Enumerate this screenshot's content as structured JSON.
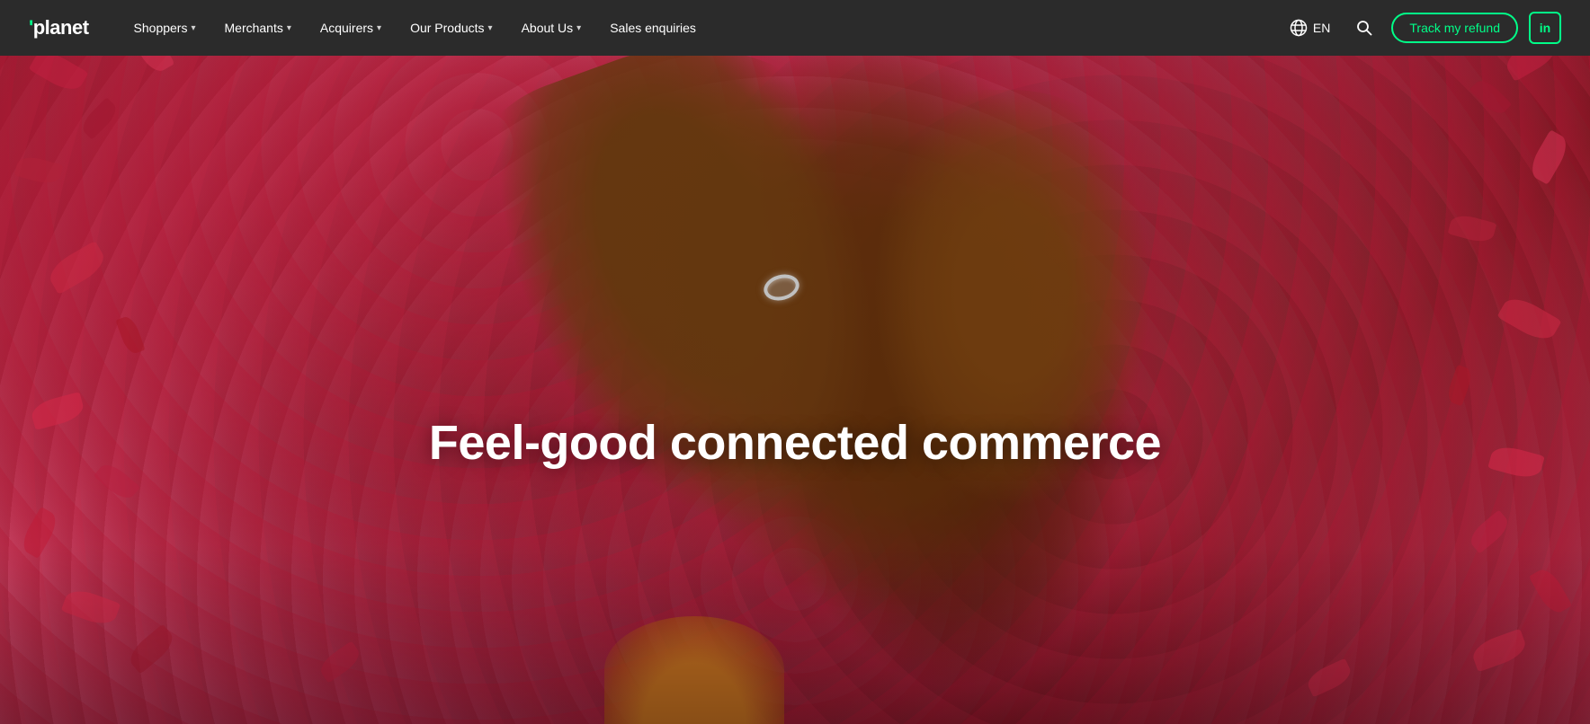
{
  "brand": {
    "name": "planet",
    "apostrophe": "'"
  },
  "navbar": {
    "background_color": "#2b2b2b",
    "items": [
      {
        "id": "shoppers",
        "label": "Shoppers",
        "has_dropdown": true
      },
      {
        "id": "merchants",
        "label": "Merchants",
        "has_dropdown": true
      },
      {
        "id": "acquirers",
        "label": "Acquirers",
        "has_dropdown": true
      },
      {
        "id": "our-products",
        "label": "Our Products",
        "has_dropdown": true
      },
      {
        "id": "about-us",
        "label": "About Us",
        "has_dropdown": true
      },
      {
        "id": "sales-enquiries",
        "label": "Sales enquiries",
        "has_dropdown": false
      }
    ],
    "lang": {
      "code": "EN",
      "icon": "globe"
    },
    "cta": {
      "label": "Track my refund",
      "border_color": "#00ff88",
      "text_color": "#00ff88"
    },
    "linkedin": {
      "label": "in",
      "border_color": "#00ff88",
      "text_color": "#00ff88"
    }
  },
  "hero": {
    "headline": "Feel-good connected commerce",
    "text_color": "#ffffff"
  }
}
